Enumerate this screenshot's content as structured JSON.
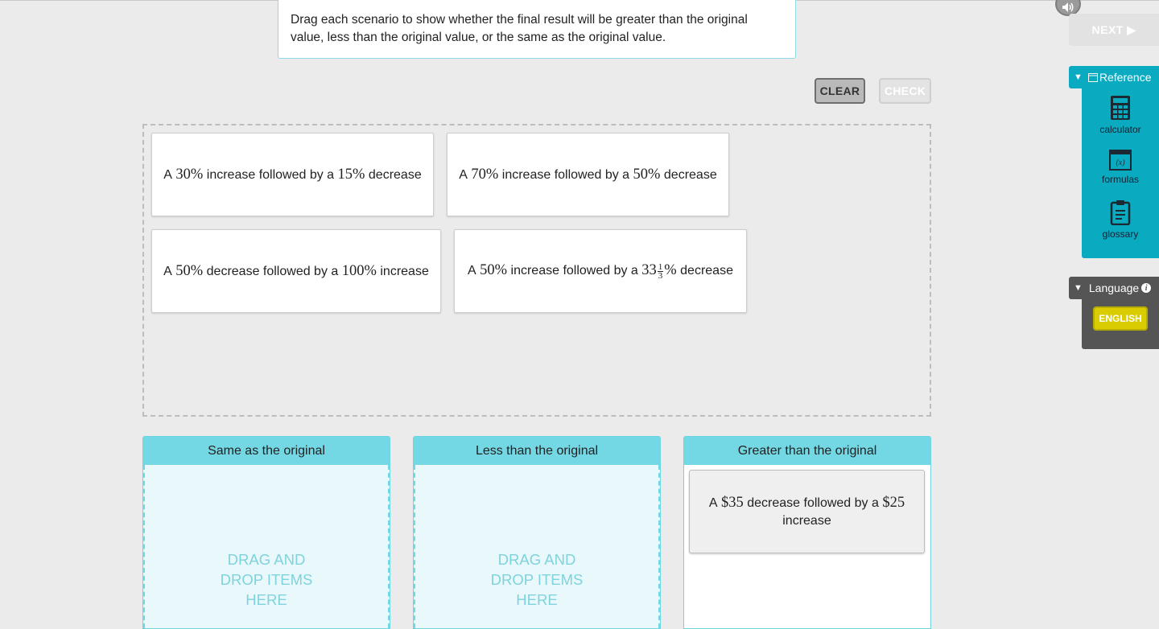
{
  "instruction": "Drag each scenario to show whether the final result will be greater than the original value, less than the original value, or the same as the original value.",
  "buttons": {
    "clear": "CLEAR",
    "check": "CHECK",
    "next": "NEXT ▶"
  },
  "cards": [
    {
      "a": "A",
      "p1": "30%",
      "mid": "increase followed by a",
      "p2": "15%",
      "end": "decrease"
    },
    {
      "a": "A",
      "p1": "70%",
      "mid": "increase followed by a",
      "p2": "50%",
      "end": "decrease"
    },
    {
      "a": "A",
      "p1": "50%",
      "mid": "decrease followed by a",
      "p2": "100%",
      "end": "increase"
    },
    {
      "a": "A",
      "p1": "50%",
      "mid": "increase followed by a",
      "p2_whole": "33",
      "p2_num": "1",
      "p2_den": "3",
      "p2_pct": "%",
      "end": "decrease"
    }
  ],
  "bins": [
    {
      "title": "Same as the original",
      "hint": "DRAG AND\nDROP ITEMS\nHERE"
    },
    {
      "title": "Less than the original",
      "hint": "DRAG AND\nDROP ITEMS\nHERE"
    },
    {
      "title": "Greater than the original",
      "placed": {
        "a": "A",
        "v1": "$35",
        "mid": "decrease followed by a",
        "v2": "$25",
        "end": "increase"
      }
    }
  ],
  "sidebar": {
    "reference_label": "Reference",
    "tools": [
      {
        "label": "calculator",
        "icon": "calculator-icon"
      },
      {
        "label": "formulas",
        "icon": "formulas-icon"
      },
      {
        "label": "glossary",
        "icon": "glossary-icon"
      }
    ],
    "language_label": "Language",
    "language_button": "ENGLISH"
  },
  "colors": {
    "accent": "#0aaac1",
    "bin_header": "#74d7e4",
    "language_button": "#d9cc00"
  }
}
